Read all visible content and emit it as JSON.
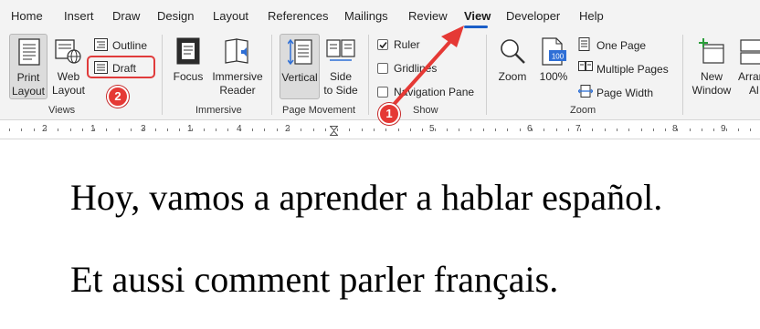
{
  "tabs": [
    "Home",
    "Insert",
    "Draw",
    "Design",
    "Layout",
    "References",
    "Mailings",
    "Review",
    "View",
    "Developer",
    "Help"
  ],
  "active_tab": "View",
  "ribbon": {
    "views": {
      "print_layout_line1": "Print",
      "print_layout_line2": "Layout",
      "web_layout_line1": "Web",
      "web_layout_line2": "Layout",
      "outline": "Outline",
      "draft": "Draft",
      "group_label": "Views"
    },
    "immersive": {
      "focus": "Focus",
      "immersive_reader_line1": "Immersive",
      "immersive_reader_line2": "Reader",
      "group_label": "Immersive"
    },
    "page_movement": {
      "vertical": "Vertical",
      "side_line1": "Side",
      "side_line2": "to Side",
      "group_label": "Page Movement"
    },
    "show": {
      "ruler": "Ruler",
      "ruler_checked": true,
      "gridlines": "Gridlines",
      "gridlines_checked": false,
      "navigation_pane": "Navigation Pane",
      "navigation_pane_checked": false,
      "group_label": "Show"
    },
    "zoom": {
      "zoom": "Zoom",
      "hundred": "100%",
      "one_page": "One Page",
      "multiple_pages": "Multiple Pages",
      "page_width": "Page Width",
      "group_label": "Zoom"
    },
    "window": {
      "new_window_line1": "New",
      "new_window_line2": "Window",
      "arrange_line1": "Arran",
      "arrange_line2": "Al"
    }
  },
  "ruler_numbers": [
    "2",
    "1",
    "1",
    "2",
    "3",
    "4",
    "5",
    "6",
    "7",
    "8",
    "9"
  ],
  "document": {
    "line1": "Hoy, vamos a aprender a hablar español.",
    "line2": "Et aussi comment parler français."
  },
  "annotations": {
    "badge1": "1",
    "badge2": "2"
  },
  "colors": {
    "accent": "#1a5ec7",
    "annotation_red": "#e53935"
  }
}
